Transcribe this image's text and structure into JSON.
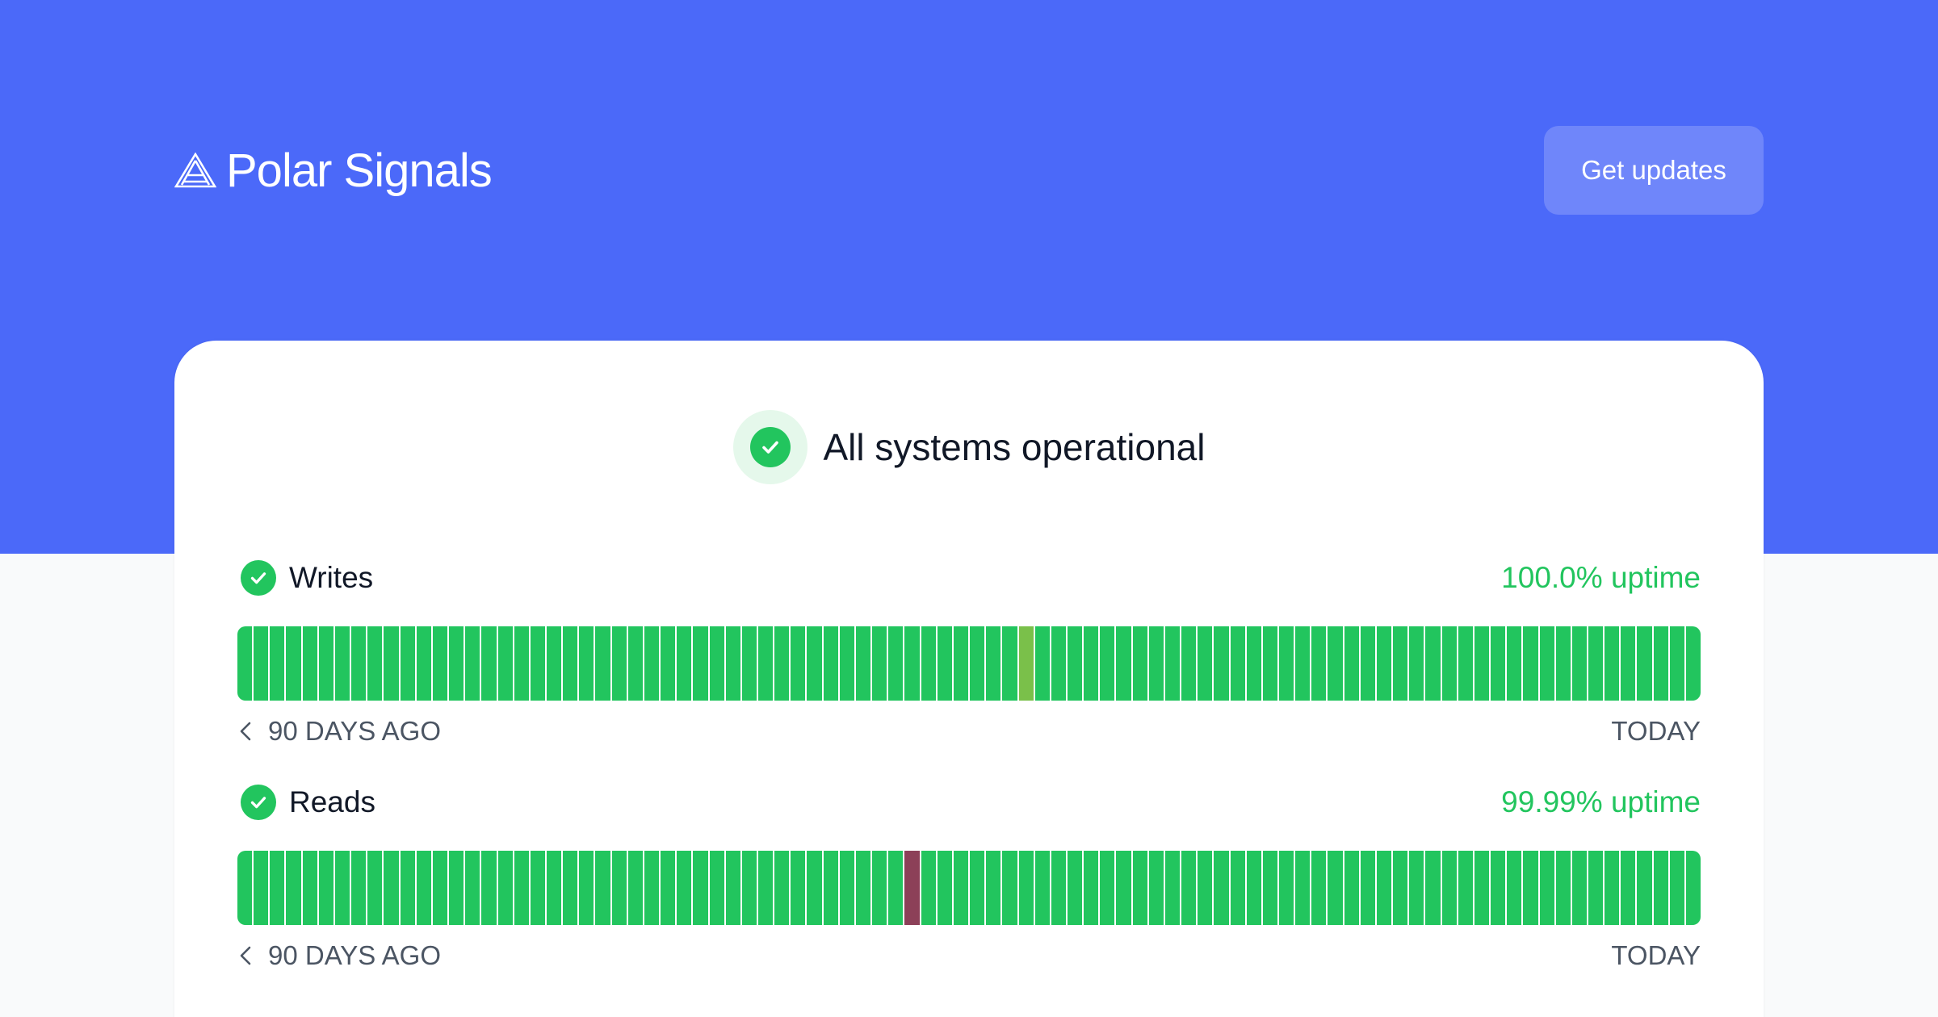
{
  "brand": {
    "name": "Polar Signals",
    "logo_icon": "polar-signals-triangle-logo",
    "text_color": "#ffffff"
  },
  "header": {
    "updates_button_label": "Get updates"
  },
  "colors": {
    "hero_bg": "#4b69f9",
    "operational": "#22c55e",
    "partial": "#7ac04a",
    "outage": "#8c4058",
    "muted_text": "#4b5563"
  },
  "status": {
    "summary": "All systems operational",
    "icon": "check-circle-icon"
  },
  "components": [
    {
      "name": "Writes",
      "uptime": "100.0% uptime",
      "range_start": "90 DAYS AGO",
      "range_end": "TODAY",
      "days": [
        "up",
        "up",
        "up",
        "up",
        "up",
        "up",
        "up",
        "up",
        "up",
        "up",
        "up",
        "up",
        "up",
        "up",
        "up",
        "up",
        "up",
        "up",
        "up",
        "up",
        "up",
        "up",
        "up",
        "up",
        "up",
        "up",
        "up",
        "up",
        "up",
        "up",
        "up",
        "up",
        "up",
        "up",
        "up",
        "up",
        "up",
        "up",
        "up",
        "up",
        "up",
        "up",
        "up",
        "up",
        "up",
        "up",
        "up",
        "up",
        "partial",
        "up",
        "up",
        "up",
        "up",
        "up",
        "up",
        "up",
        "up",
        "up",
        "up",
        "up",
        "up",
        "up",
        "up",
        "up",
        "up",
        "up",
        "up",
        "up",
        "up",
        "up",
        "up",
        "up",
        "up",
        "up",
        "up",
        "up",
        "up",
        "up",
        "up",
        "up",
        "up",
        "up",
        "up",
        "up",
        "up",
        "up",
        "up",
        "up",
        "up",
        "up"
      ]
    },
    {
      "name": "Reads",
      "uptime": "99.99% uptime",
      "range_start": "90 DAYS AGO",
      "range_end": "TODAY",
      "days": [
        "up",
        "up",
        "up",
        "up",
        "up",
        "up",
        "up",
        "up",
        "up",
        "up",
        "up",
        "up",
        "up",
        "up",
        "up",
        "up",
        "up",
        "up",
        "up",
        "up",
        "up",
        "up",
        "up",
        "up",
        "up",
        "up",
        "up",
        "up",
        "up",
        "up",
        "up",
        "up",
        "up",
        "up",
        "up",
        "up",
        "up",
        "up",
        "up",
        "up",
        "up",
        "outage",
        "up",
        "up",
        "up",
        "up",
        "up",
        "up",
        "up",
        "up",
        "up",
        "up",
        "up",
        "up",
        "up",
        "up",
        "up",
        "up",
        "up",
        "up",
        "up",
        "up",
        "up",
        "up",
        "up",
        "up",
        "up",
        "up",
        "up",
        "up",
        "up",
        "up",
        "up",
        "up",
        "up",
        "up",
        "up",
        "up",
        "up",
        "up",
        "up",
        "up",
        "up",
        "up",
        "up",
        "up",
        "up",
        "up",
        "up",
        "up"
      ]
    }
  ]
}
